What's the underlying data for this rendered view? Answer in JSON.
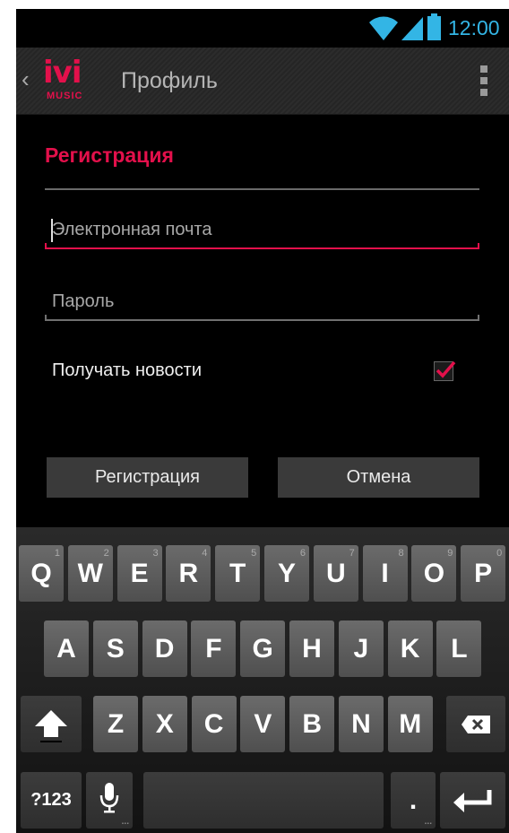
{
  "status_bar": {
    "time": "12:00",
    "wifi_icon": "wifi-icon",
    "signal_icon": "signal-icon",
    "battery_icon": "battery-icon"
  },
  "action_bar": {
    "logo_text": "ivi",
    "logo_sub": "MUSIC",
    "title": "Профиль"
  },
  "form": {
    "section_title": "Регистрация",
    "email_placeholder": "Электронная почта",
    "password_placeholder": "Пароль",
    "news_label": "Получать новости",
    "news_checked": true,
    "register_button": "Регистрация",
    "cancel_button": "Отмена"
  },
  "colors": {
    "accent": "#e3104b",
    "status_blue": "#33b5e5",
    "background": "#000000"
  },
  "keyboard": {
    "row1": [
      {
        "k": "Q",
        "h": "1"
      },
      {
        "k": "W",
        "h": "2"
      },
      {
        "k": "E",
        "h": "3"
      },
      {
        "k": "R",
        "h": "4"
      },
      {
        "k": "T",
        "h": "5"
      },
      {
        "k": "Y",
        "h": "6"
      },
      {
        "k": "U",
        "h": "7"
      },
      {
        "k": "I",
        "h": "8"
      },
      {
        "k": "O",
        "h": "9"
      },
      {
        "k": "P",
        "h": "0"
      }
    ],
    "row2": [
      "A",
      "S",
      "D",
      "F",
      "G",
      "H",
      "J",
      "K",
      "L"
    ],
    "row3": [
      "Z",
      "X",
      "C",
      "V",
      "B",
      "N",
      "M"
    ],
    "symbols_key": "?123",
    "period_key": ".",
    "shift_icon": "shift-icon",
    "backspace_icon": "backspace-icon",
    "mic_icon": "microphone-icon",
    "enter_icon": "enter-icon"
  }
}
